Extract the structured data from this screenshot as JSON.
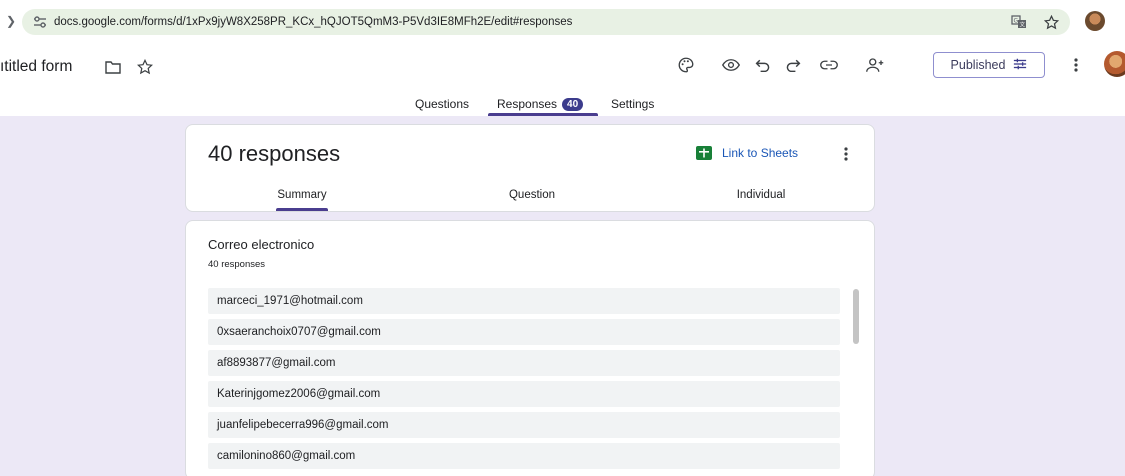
{
  "browser": {
    "url": "docs.google.com/forms/d/1xPx9jyW8X258PR_KCx_hQJOT5QmM3-P5Vd3IE8MFh2E/edit#responses",
    "icons": [
      "tune-icon",
      "translate-icon",
      "star-icon",
      "profile-avatar"
    ]
  },
  "toolbar": {
    "form_title": "ıtitled form",
    "published_label": "Published",
    "icons": [
      "folder-icon",
      "star-icon",
      "palette-icon",
      "preview-icon",
      "undo-icon",
      "redo-icon",
      "link-icon",
      "add-collaborator-icon",
      "more-vert-icon"
    ]
  },
  "tabs": {
    "questions": "Questions",
    "responses": "Responses",
    "responses_badge": "40",
    "settings": "Settings"
  },
  "summary_card": {
    "count_label": "40 responses",
    "link_to_sheets": "Link to Sheets",
    "subtabs": {
      "summary": "Summary",
      "question": "Question",
      "individual": "Individual"
    }
  },
  "question_card": {
    "title": "Correo electronico",
    "count": "40 responses",
    "responses": [
      "marceci_1971@hotmail.com",
      "0xsaeranchoix0707@gmail.com",
      "af8893877@gmail.com",
      "Katerinjgomez2006@gmail.com",
      "juanfelipebecerra996@gmail.com",
      "camilonino860@gmail.com"
    ]
  },
  "colors": {
    "accent": "#4a3d8f",
    "page_background": "#ece8f6",
    "url_bar": "#e8f1e4",
    "link": "#1a56b6",
    "sheets_green": "#188038"
  }
}
